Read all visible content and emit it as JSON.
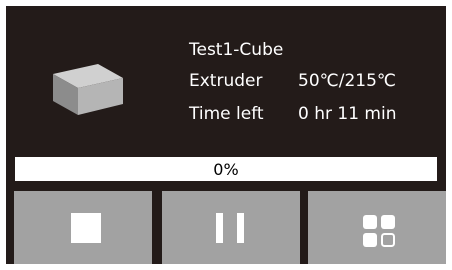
{
  "job": {
    "name": "Test1-Cube",
    "extruder_label": "Extruder",
    "extruder_value": "50℃/215℃",
    "time_left_label": "Time left",
    "time_left_value": "0 hr 11 min"
  },
  "progress": {
    "label": "0%",
    "value_fraction": 0.0
  },
  "buttons": {
    "stop_icon": "stop-icon",
    "pause_icon": "pause-icon",
    "more_icon": "more-options-icon"
  },
  "colors": {
    "background": "#231b19",
    "button": "#a2a2a2",
    "progress_track": "#ffffff",
    "text": "#ffffff"
  }
}
